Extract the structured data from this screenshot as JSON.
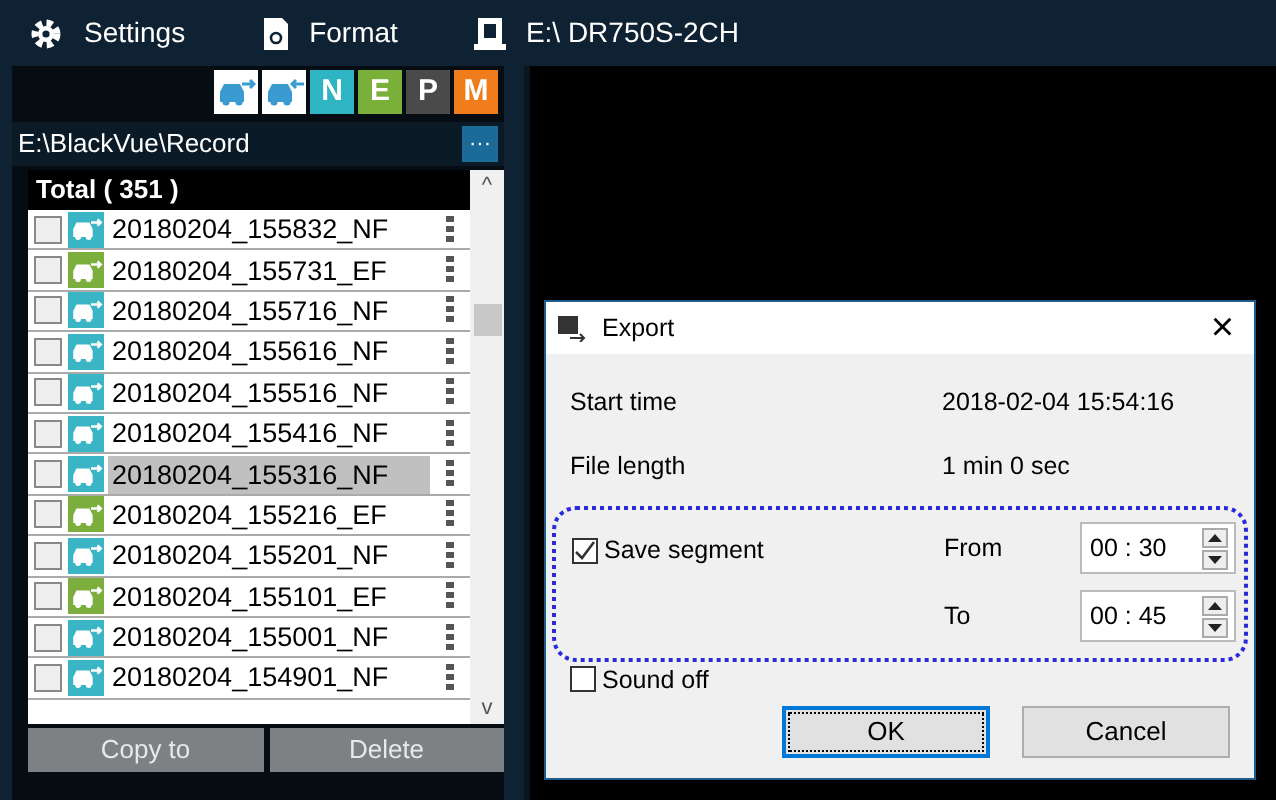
{
  "toolbar": [
    {
      "label": "Settings",
      "kind": "gear"
    },
    {
      "label": "Format",
      "kind": "sdcard"
    },
    {
      "label": "E:\\ DR750S-2CH",
      "kind": "drive"
    }
  ],
  "filters": [
    {
      "kind": "car-out"
    },
    {
      "kind": "car-in"
    },
    {
      "kind": "letter",
      "label": "N",
      "color": "#2fb4c4"
    },
    {
      "kind": "letter",
      "label": "E",
      "color": "#7aaf3a"
    },
    {
      "kind": "letter",
      "label": "P",
      "color": "#4a4a4a"
    },
    {
      "kind": "letter",
      "label": "M",
      "color": "#f07c1c"
    }
  ],
  "path": {
    "value": "E:\\BlackVue\\Record",
    "button": "···"
  },
  "list_header": "Total ( 351 )",
  "files": [
    {
      "name": "20180204_155832_NF",
      "color": "#3ab5c6",
      "checked": false,
      "selected": false
    },
    {
      "name": "20180204_155731_EF",
      "color": "#7cae3e",
      "checked": false,
      "selected": false
    },
    {
      "name": "20180204_155716_NF",
      "color": "#3ab5c6",
      "checked": false,
      "selected": false
    },
    {
      "name": "20180204_155616_NF",
      "color": "#3ab5c6",
      "checked": false,
      "selected": false
    },
    {
      "name": "20180204_155516_NF",
      "color": "#3ab5c6",
      "checked": false,
      "selected": false
    },
    {
      "name": "20180204_155416_NF",
      "color": "#3ab5c6",
      "checked": false,
      "selected": false
    },
    {
      "name": "20180204_155316_NF",
      "color": "#3ab5c6",
      "checked": false,
      "selected": true
    },
    {
      "name": "20180204_155216_EF",
      "color": "#7cae3e",
      "checked": false,
      "selected": false
    },
    {
      "name": "20180204_155201_NF",
      "color": "#3ab5c6",
      "checked": false,
      "selected": false
    },
    {
      "name": "20180204_155101_EF",
      "color": "#7cae3e",
      "checked": false,
      "selected": false
    },
    {
      "name": "20180204_155001_NF",
      "color": "#3ab5c6",
      "checked": false,
      "selected": false
    },
    {
      "name": "20180204_154901_NF",
      "color": "#3ab5c6",
      "checked": false,
      "selected": false
    }
  ],
  "scrollbar": {
    "up": "^",
    "down": "v"
  },
  "actions": [
    "Copy to",
    "Delete"
  ],
  "dialog": {
    "title": "Export",
    "close": "×",
    "fields": [
      {
        "label": "Start time",
        "value": "2018-02-04 15:54:16"
      },
      {
        "label": "File length",
        "value": "1 min 0 sec"
      }
    ],
    "save_segment": {
      "label": "Save segment",
      "checked": true
    },
    "from": {
      "label": "From",
      "value": "00 : 30"
    },
    "to": {
      "label": "To",
      "value": "00 : 45"
    },
    "sound_off": {
      "label": "Sound off",
      "checked": false
    },
    "buttons": [
      {
        "label": "OK",
        "default": true
      },
      {
        "label": "Cancel",
        "default": false
      }
    ]
  }
}
